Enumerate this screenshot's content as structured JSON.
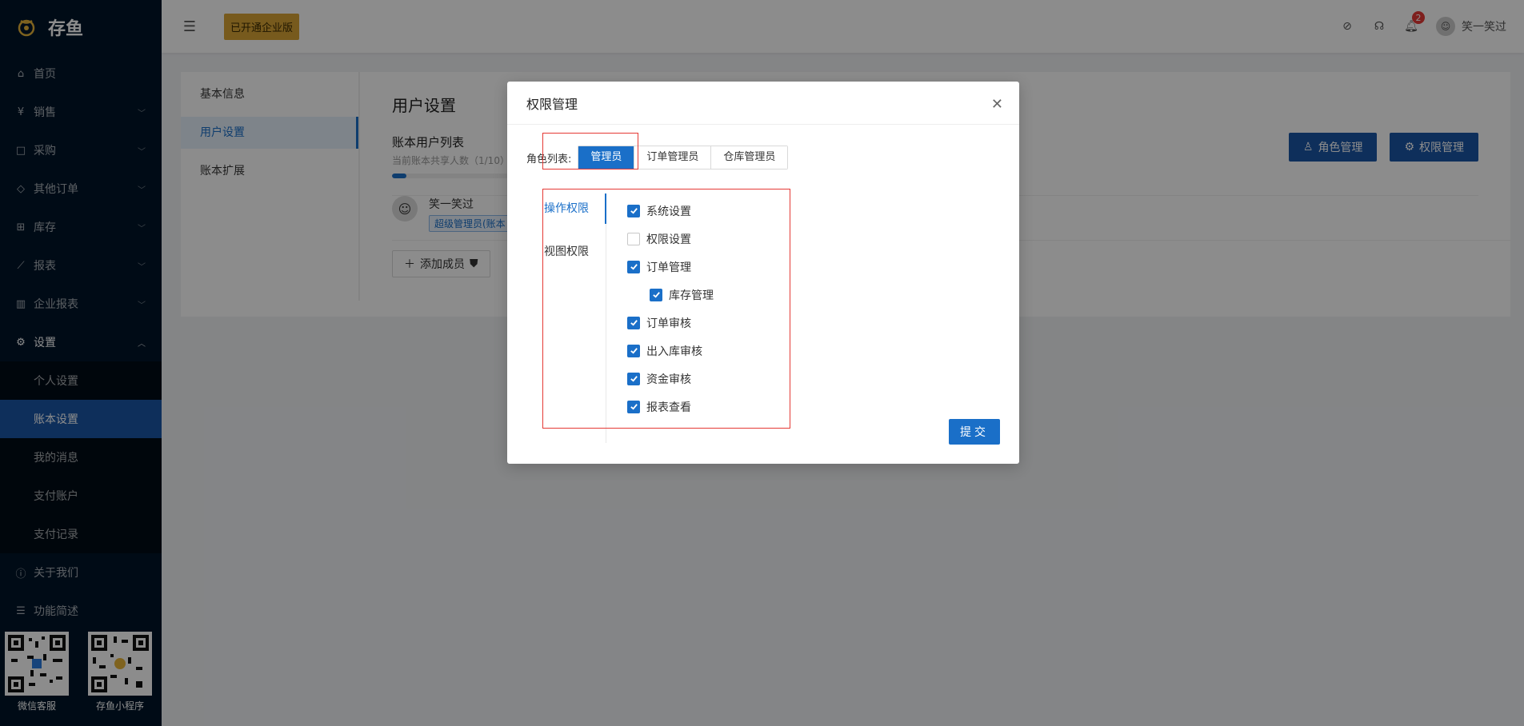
{
  "app": {
    "logo_text": "存鱼"
  },
  "sidebar": {
    "items": [
      {
        "label": "首页",
        "icon": "home-icon"
      },
      {
        "label": "销售",
        "icon": "yen-icon"
      },
      {
        "label": "采购",
        "icon": "bag-icon"
      },
      {
        "label": "其他订单",
        "icon": "tag-icon"
      },
      {
        "label": "库存",
        "icon": "cart-icon"
      },
      {
        "label": "报表",
        "icon": "line-chart-icon"
      },
      {
        "label": "企业报表",
        "icon": "bar-chart-icon"
      },
      {
        "label": "设置",
        "icon": "gear-icon"
      }
    ],
    "settings_sub": [
      {
        "label": "个人设置"
      },
      {
        "label": "账本设置"
      },
      {
        "label": "我的消息"
      },
      {
        "label": "支付账户"
      },
      {
        "label": "支付记录"
      }
    ],
    "bottom_items": [
      {
        "label": "关于我们",
        "icon": "info-icon"
      },
      {
        "label": "功能简述",
        "icon": "list-icon"
      }
    ],
    "qr": [
      {
        "caption": "微信客服"
      },
      {
        "caption": "存鱼小程序"
      }
    ]
  },
  "header": {
    "badge": "已开通企业版",
    "notification_count": "2",
    "user_name": "笑一笑过"
  },
  "content": {
    "left_nav": [
      "基本信息",
      "用户设置",
      "账本扩展"
    ],
    "page_title": "用户设置",
    "list_title": "账本用户列表",
    "list_sub": "当前账本共享人数（1/10）",
    "progress": 0.1,
    "user_name": "笑一笑过",
    "role_tag": "超级管理员(账本",
    "add_member": "添加成员",
    "role_manage_btn": "角色管理",
    "perm_manage_btn": "权限管理"
  },
  "modal": {
    "title": "权限管理",
    "role_label": "角色列表:",
    "roles": [
      "管理员",
      "订单管理员",
      "仓库管理员"
    ],
    "perm_tabs": [
      "操作权限",
      "视图权限"
    ],
    "permissions": [
      {
        "label": "系统设置",
        "checked": true,
        "indent": false
      },
      {
        "label": "权限设置",
        "checked": false,
        "indent": false
      },
      {
        "label": "订单管理",
        "checked": true,
        "indent": false
      },
      {
        "label": "库存管理",
        "checked": true,
        "indent": true
      },
      {
        "label": "订单审核",
        "checked": true,
        "indent": false
      },
      {
        "label": "出入库审核",
        "checked": true,
        "indent": false
      },
      {
        "label": "资金审核",
        "checked": true,
        "indent": false
      },
      {
        "label": "报表查看",
        "checked": true,
        "indent": false
      }
    ],
    "submit": "提交"
  },
  "colors": {
    "sidebar_bg": "#001529",
    "primary": "#1a6fc8",
    "badge_gold": "#d9a536",
    "highlight_red": "#e53935"
  }
}
